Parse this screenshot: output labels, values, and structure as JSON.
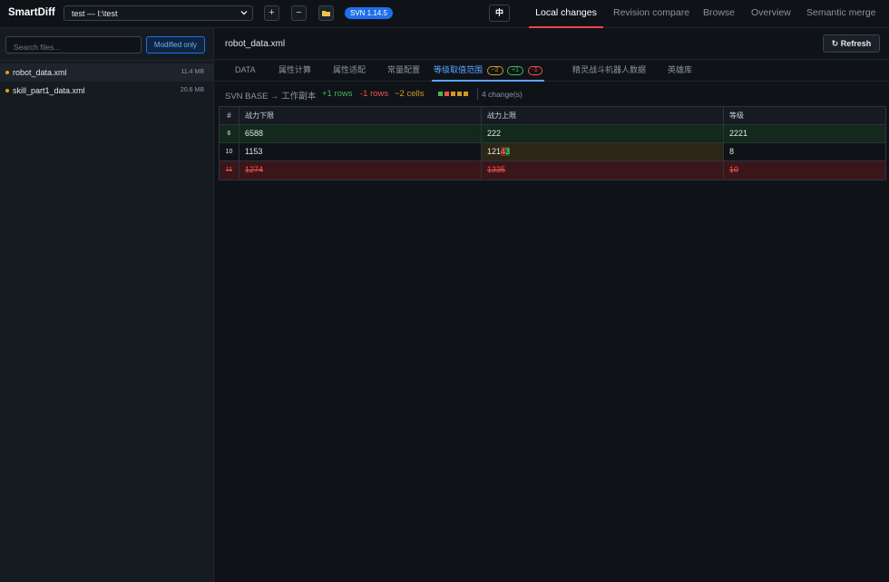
{
  "app": {
    "title": "SmartDiff",
    "repo_select": "test — I:\\test",
    "svn_version": "SVN 1.14.5",
    "lang_button": "中",
    "add_label": "+",
    "remove_label": "−"
  },
  "nav": {
    "tabs": [
      {
        "label": "Local changes",
        "active": true
      },
      {
        "label": "Revision compare",
        "active": false
      },
      {
        "label": "Browse",
        "active": false
      },
      {
        "label": "Overview",
        "active": false
      },
      {
        "label": "Semantic merge",
        "active": false
      }
    ]
  },
  "sidebar": {
    "search_placeholder": "Search files...",
    "filter_button": "Modified only",
    "files": [
      {
        "name": "robot_data.xml",
        "size": "11.4 MB",
        "active": true
      },
      {
        "name": "skill_part1_data.xml",
        "size": "20.6 MB",
        "active": false
      }
    ]
  },
  "main": {
    "file_title": "robot_data.xml",
    "refresh_label": "↻ Refresh",
    "sheet_tabs": [
      {
        "label": "DATA"
      },
      {
        "label": "属性计算"
      },
      {
        "label": "属性适配"
      },
      {
        "label": "常量配置"
      },
      {
        "label": "等级取值范围",
        "active": true,
        "badges": {
          "mod": "~2",
          "add": "+1",
          "del": "-1"
        }
      },
      {
        "label": "精灵战斗机器人数据"
      },
      {
        "label": "英雄库"
      }
    ],
    "summary": {
      "compare": "SVN BASE → 工作副本",
      "added_rows": "+1 rows",
      "removed_rows": "-1 rows",
      "changed_cells": "~2 cells",
      "changes_count": "4 change(s)"
    },
    "colors": {
      "added": "#3fb950",
      "removed": "#f85149",
      "modified": "#d29922",
      "accent": "#58a6ff"
    },
    "table": {
      "headers": [
        "#",
        "战力下限",
        "战力上限",
        "等级"
      ],
      "rows": [
        {
          "status": "added",
          "cells": [
            "6",
            "6588",
            "222",
            "2221"
          ]
        },
        {
          "status": "modified",
          "cells": [
            "10",
            "1153",
            "121",
            "8"
          ],
          "diff": {
            "prefix": "121",
            "removed": "4",
            "added": "3"
          }
        },
        {
          "status": "removed",
          "cells": [
            "11",
            "1274",
            "1335",
            "10"
          ]
        }
      ]
    }
  }
}
